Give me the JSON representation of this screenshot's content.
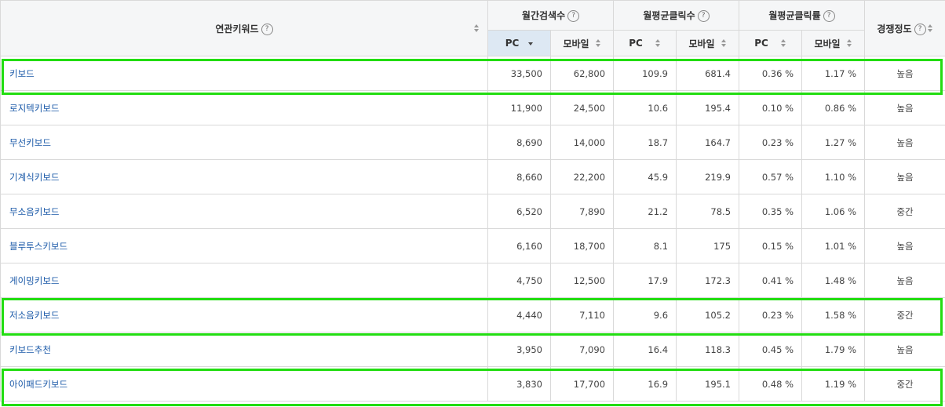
{
  "header": {
    "keyword": "연관키워드",
    "monthly_search": "월간검색수",
    "monthly_clicks": "월평균클릭수",
    "monthly_ctr": "월평균클릭률",
    "competition": "경쟁정도",
    "pc": "PC",
    "mobile": "모바일",
    "help_glyph": "?"
  },
  "rows": [
    {
      "keyword": "키보드",
      "search_pc": "33,500",
      "search_mobile": "62,800",
      "clicks_pc": "109.9",
      "clicks_mobile": "681.4",
      "ctr_pc": "0.36 %",
      "ctr_mobile": "1.17 %",
      "competition": "높음"
    },
    {
      "keyword": "로지텍키보드",
      "search_pc": "11,900",
      "search_mobile": "24,500",
      "clicks_pc": "10.6",
      "clicks_mobile": "195.4",
      "ctr_pc": "0.10 %",
      "ctr_mobile": "0.86 %",
      "competition": "높음"
    },
    {
      "keyword": "무선키보드",
      "search_pc": "8,690",
      "search_mobile": "14,000",
      "clicks_pc": "18.7",
      "clicks_mobile": "164.7",
      "ctr_pc": "0.23 %",
      "ctr_mobile": "1.27 %",
      "competition": "높음"
    },
    {
      "keyword": "기계식키보드",
      "search_pc": "8,660",
      "search_mobile": "22,200",
      "clicks_pc": "45.9",
      "clicks_mobile": "219.9",
      "ctr_pc": "0.57 %",
      "ctr_mobile": "1.10 %",
      "competition": "높음"
    },
    {
      "keyword": "무소음키보드",
      "search_pc": "6,520",
      "search_mobile": "7,890",
      "clicks_pc": "21.2",
      "clicks_mobile": "78.5",
      "ctr_pc": "0.35 %",
      "ctr_mobile": "1.06 %",
      "competition": "중간"
    },
    {
      "keyword": "블루투스키보드",
      "search_pc": "6,160",
      "search_mobile": "18,700",
      "clicks_pc": "8.1",
      "clicks_mobile": "175",
      "ctr_pc": "0.15 %",
      "ctr_mobile": "1.01 %",
      "competition": "높음"
    },
    {
      "keyword": "게이밍키보드",
      "search_pc": "4,750",
      "search_mobile": "12,500",
      "clicks_pc": "17.9",
      "clicks_mobile": "172.3",
      "ctr_pc": "0.41 %",
      "ctr_mobile": "1.48 %",
      "competition": "높음"
    },
    {
      "keyword": "저소음키보드",
      "search_pc": "4,440",
      "search_mobile": "7,110",
      "clicks_pc": "9.6",
      "clicks_mobile": "105.2",
      "ctr_pc": "0.23 %",
      "ctr_mobile": "1.58 %",
      "competition": "중간"
    },
    {
      "keyword": "키보드추천",
      "search_pc": "3,950",
      "search_mobile": "7,090",
      "clicks_pc": "16.4",
      "clicks_mobile": "118.3",
      "ctr_pc": "0.45 %",
      "ctr_mobile": "1.79 %",
      "competition": "높음"
    },
    {
      "keyword": "아이패드키보드",
      "search_pc": "3,830",
      "search_mobile": "17,700",
      "clicks_pc": "16.9",
      "clicks_mobile": "195.1",
      "ctr_pc": "0.48 %",
      "ctr_mobile": "1.19 %",
      "competition": "중간"
    }
  ],
  "colors": {
    "highlight": "#22dd11",
    "keyword_link": "#1a59a8",
    "active_sort_header": "#dde8f3",
    "header_bg": "#f5f6f7"
  }
}
